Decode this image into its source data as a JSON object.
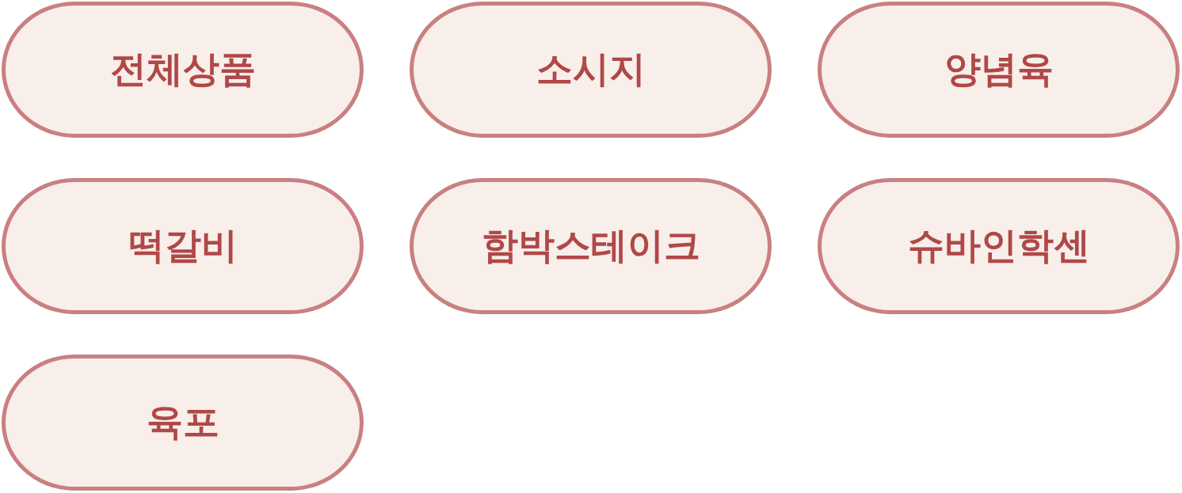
{
  "category_buttons": [
    {
      "label": "전체상품"
    },
    {
      "label": "소시지"
    },
    {
      "label": "양념육"
    },
    {
      "label": "떡갈비"
    },
    {
      "label": "함박스테이크"
    },
    {
      "label": "슈바인학센"
    },
    {
      "label": "육포"
    }
  ]
}
